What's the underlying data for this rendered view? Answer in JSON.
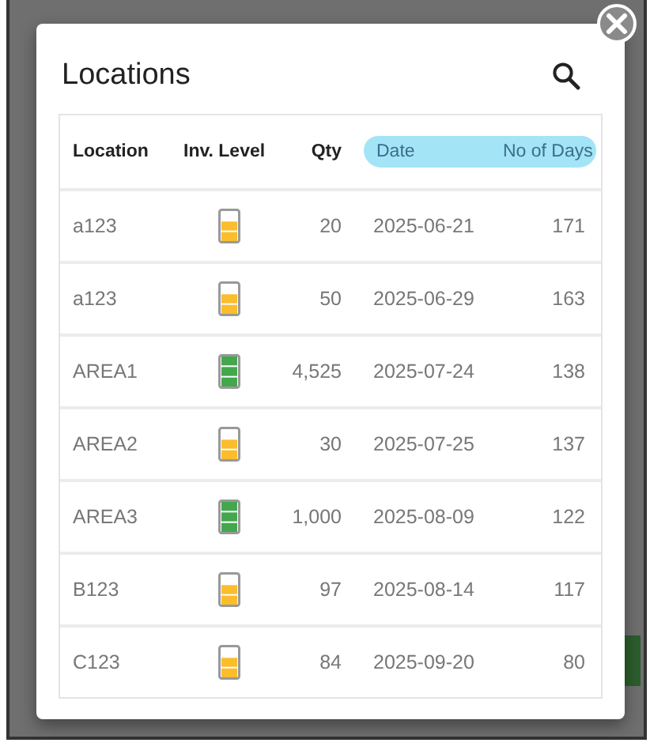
{
  "dialog": {
    "title": "Locations",
    "table": {
      "columns": [
        {
          "label": "Location",
          "highlighted": false
        },
        {
          "label": "Inv. Level",
          "highlighted": false
        },
        {
          "label": "Qty",
          "highlighted": false
        },
        {
          "label": "Date",
          "highlighted": true
        },
        {
          "label": "No of Days",
          "highlighted": true
        }
      ],
      "rows": [
        {
          "location": "a123",
          "inv_level": {
            "level": 0.67,
            "color": "#fbbd2c"
          },
          "qty": "20",
          "date": "2025-06-21",
          "days": "171"
        },
        {
          "location": "a123",
          "inv_level": {
            "level": 0.67,
            "color": "#fbbd2c"
          },
          "qty": "50",
          "date": "2025-06-29",
          "days": "163"
        },
        {
          "location": "AREA1",
          "inv_level": {
            "level": 1,
            "color": "#43a84c"
          },
          "qty": "4,525",
          "date": "2025-07-24",
          "days": "138"
        },
        {
          "location": "AREA2",
          "inv_level": {
            "level": 0.67,
            "color": "#fbbd2c"
          },
          "qty": "30",
          "date": "2025-07-25",
          "days": "137"
        },
        {
          "location": "AREA3",
          "inv_level": {
            "level": 1,
            "color": "#43a84c"
          },
          "qty": "1,000",
          "date": "2025-08-09",
          "days": "122"
        },
        {
          "location": "B123",
          "inv_level": {
            "level": 0.67,
            "color": "#fbbd2c"
          },
          "qty": "97",
          "date": "2025-08-14",
          "days": "117"
        },
        {
          "location": "C123",
          "inv_level": {
            "level": 0.67,
            "color": "#fbbd2c"
          },
          "qty": "84",
          "date": "2025-09-20",
          "days": "80"
        }
      ]
    }
  }
}
